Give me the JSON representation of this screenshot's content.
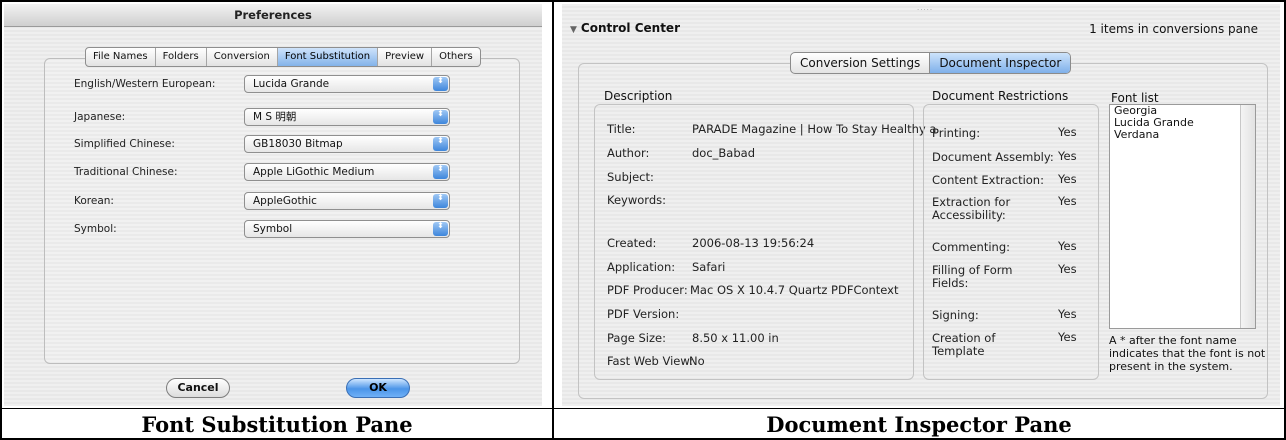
{
  "preferences": {
    "window_title": "Preferences",
    "tabs": [
      "File Names",
      "Folders",
      "Conversion",
      "Font Substitution",
      "Preview",
      "Others"
    ],
    "active_tab": "Font Substitution",
    "rows": [
      {
        "label": "English/Western European:",
        "value": "Lucida Grande"
      },
      {
        "label": "Japanese:",
        "value": "M S 明朝"
      },
      {
        "label": "Simplified Chinese:",
        "value": "GB18030 Bitmap"
      },
      {
        "label": "Traditional Chinese:",
        "value": "Apple LiGothic Medium"
      },
      {
        "label": "Korean:",
        "value": "AppleGothic"
      },
      {
        "label": "Symbol:",
        "value": "Symbol"
      }
    ],
    "cancel_label": "Cancel",
    "ok_label": "OK",
    "popup_arrow": "⬍"
  },
  "control_center": {
    "title": "Control Center",
    "disclosure": "▼",
    "items_count": "1 items in conversions pane",
    "tabs": [
      "Conversion Settings",
      "Document Inspector"
    ],
    "active_tab": "Document Inspector",
    "description": {
      "heading": "Description",
      "fields": [
        {
          "label": "Title:",
          "value": "PARADE Magazine | How To Stay Healthy a"
        },
        {
          "label": "Author:",
          "value": "doc_Babad"
        },
        {
          "label": "Subject:",
          "value": ""
        },
        {
          "label": "Keywords:",
          "value": ""
        },
        {
          "label": "Created:",
          "value": "2006-08-13 19:56:24"
        },
        {
          "label": "Application:",
          "value": "Safari"
        },
        {
          "label": "PDF Producer:",
          "value": "Mac OS X 10.4.7 Quartz PDFContext"
        },
        {
          "label": "PDF Version:",
          "value": ""
        },
        {
          "label": "Page Size:",
          "value": "8.50 x 11.00  in"
        },
        {
          "label": "Fast Web View:",
          "value": "No"
        }
      ]
    },
    "restrictions": {
      "heading": "Document Restrictions",
      "items": [
        {
          "label": "Printing:",
          "value": "Yes"
        },
        {
          "label": "Document Assembly:",
          "value": "Yes"
        },
        {
          "label": "Content Extraction:",
          "value": "Yes"
        },
        {
          "label": "Extraction for Accessibility:",
          "value": "Yes"
        },
        {
          "label": "Commenting:",
          "value": "Yes"
        },
        {
          "label": "Filling of Form Fields:",
          "value": "Yes"
        },
        {
          "label": "Signing:",
          "value": "Yes"
        },
        {
          "label": "Creation of Template",
          "value": "Yes"
        }
      ]
    },
    "font_list": {
      "heading": "Font list",
      "fonts": [
        "Georgia",
        "Lucida Grande",
        "Verdana"
      ],
      "note": "A * after the font name indicates that the font is not present in the system."
    }
  },
  "captions": {
    "left": "Font Substitution Pane",
    "right": "Document Inspector Pane"
  }
}
